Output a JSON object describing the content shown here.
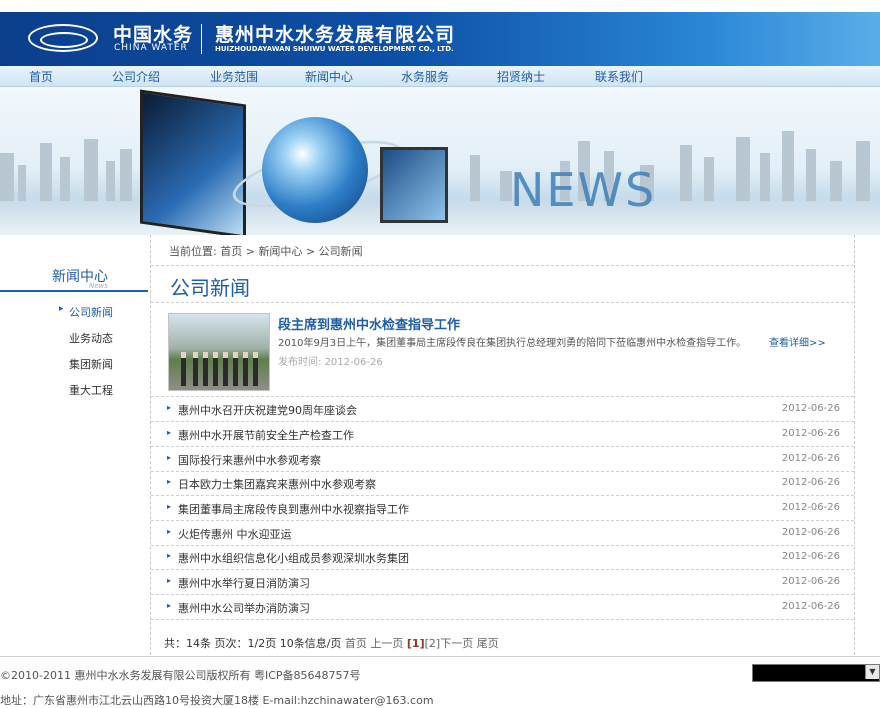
{
  "header": {
    "logo_cn": "中国水务",
    "logo_en": "CHINA WATER",
    "company_cn": "惠州中水水务发展有限公司",
    "company_en": "HUIZHOUDAYAWAN SHUIWU WATER DEVELOPMENT CO., LTD."
  },
  "nav": {
    "items": [
      "首页",
      "公司介绍",
      "业务范围",
      "新闻中心",
      "水务服务",
      "招贤纳士",
      "联系我们"
    ]
  },
  "banner": {
    "text": "NEWS"
  },
  "sidebar": {
    "title": "新闻中心",
    "subtitle": "News",
    "items": [
      "公司新闻",
      "业务动态",
      "集团新闻",
      "重大工程"
    ]
  },
  "breadcrumb": {
    "prefix": "当前位置:",
    "items": [
      "首页",
      "新闻中心",
      "公司新闻"
    ]
  },
  "main": {
    "title": "公司新闻",
    "featured": {
      "title": "段主席到惠州中水检查指导工作",
      "desc": "2010年9月3日上午，集团董事局主席段传良在集团执行总经理刘勇的陪同下莅临惠州中水检查指导工作。",
      "more": "查看详细>>",
      "date_label": "发布时间:",
      "date": "2012-06-26"
    },
    "list": [
      {
        "title": "惠州中水召开庆祝建党90周年座谈会",
        "date": "2012-06-26"
      },
      {
        "title": "惠州中水开展节前安全生产检查工作",
        "date": "2012-06-26"
      },
      {
        "title": "国际投行来惠州中水参观考察",
        "date": "2012-06-26"
      },
      {
        "title": "日本欧力士集团嘉宾来惠州中水参观考察",
        "date": "2012-06-26"
      },
      {
        "title": "集团董事局主席段传良到惠州中水视察指导工作",
        "date": "2012-06-26"
      },
      {
        "title": "火炬传惠州 中水迎亚运",
        "date": "2012-06-26"
      },
      {
        "title": "惠州中水组织信息化小组成员参观深圳水务集团",
        "date": "2012-06-26"
      },
      {
        "title": "惠州中水举行夏日消防演习",
        "date": "2012-06-26"
      },
      {
        "title": "惠州中水公司举办消防演习",
        "date": "2012-06-26"
      }
    ]
  },
  "pager": {
    "total": "共：14条",
    "pages": "页次：1/2页",
    "per_page": "10条信息/页",
    "first": "首页",
    "prev": "上一页",
    "cur": "[1]",
    "p2": "[2]",
    "next": "下一页",
    "last": "尾页"
  },
  "footer": {
    "copyright": "©2010-2011 惠州中水水务发展有限公司版权所有 粤ICP备85648757号",
    "address": "地址：广东省惠州市江北云山西路10号投资大厦18楼   E-mail:hzchinawater@163.com",
    "select_value": ""
  }
}
